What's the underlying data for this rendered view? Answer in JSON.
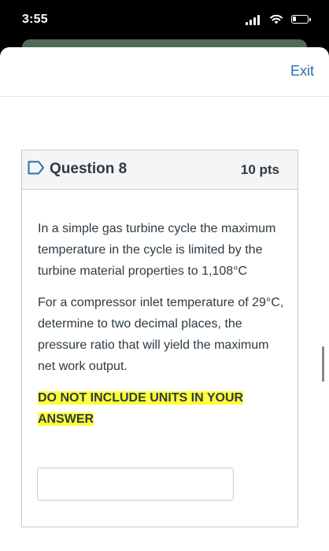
{
  "status_bar": {
    "time": "3:55",
    "signal_icon": "cellular-signal-icon",
    "wifi_icon": "wifi-icon",
    "battery_icon": "battery-low-icon",
    "battery_level": 0.2
  },
  "header": {
    "exit_label": "Exit",
    "link_color": "#2a6fb0"
  },
  "question": {
    "flag_icon": "flag-icon",
    "title": "Question 8",
    "points": "10 pts",
    "paragraph_1": "In a simple gas turbine cycle the maximum temperature in the cycle is limited  by the turbine material properties to 1,108°C",
    "paragraph_2": "For a compressor inlet temperature of 29°C, determine to two decimal places, the pressure ratio that will yield the maximum net work output.",
    "instruction": "DO NOT INCLUDE UNITS IN YOUR ANSWER",
    "highlight_color": "#ffff3a",
    "answer_value": "",
    "answer_placeholder": ""
  }
}
